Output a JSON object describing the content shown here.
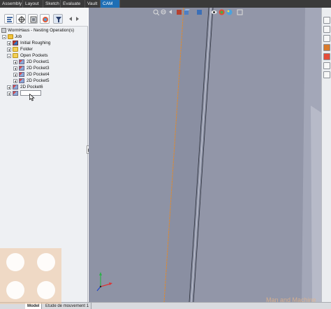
{
  "tabs": [
    "Assembly",
    "Layout",
    "Sketch",
    "Evaluate",
    "Vault",
    "CAM"
  ],
  "active_tab": "CAM",
  "panel_tabs": [
    "feature-manager-icon",
    "property-manager-icon",
    "configuration-manager-icon",
    "display-manager-icon",
    "cam-manager-icon"
  ],
  "tree": {
    "root": "WormHaus - Nesting Operation(s)",
    "job": "Job",
    "initial_roughing": "Initial Roughing",
    "folder": "Folder",
    "open_pockets": "Open Pockets",
    "pockets": [
      "2D Pocket1",
      "2D Pocket3",
      "2D Pocket4",
      "2D Pocket5"
    ],
    "pocket6": "2D Pocket6"
  },
  "bottom_tabs": [
    "Model",
    "Etude de mouvement 1"
  ],
  "active_bottom_tab": "Model",
  "watermark": "Man and Machine",
  "colors": {
    "viewport_bg": "#8e93a5",
    "cam_tab": "#1f6fb5",
    "tabbar": "#3a3a3a",
    "watermark": "#e3b48a",
    "part_face": "#9498aa",
    "edge_highlight": "#e08a2e"
  }
}
